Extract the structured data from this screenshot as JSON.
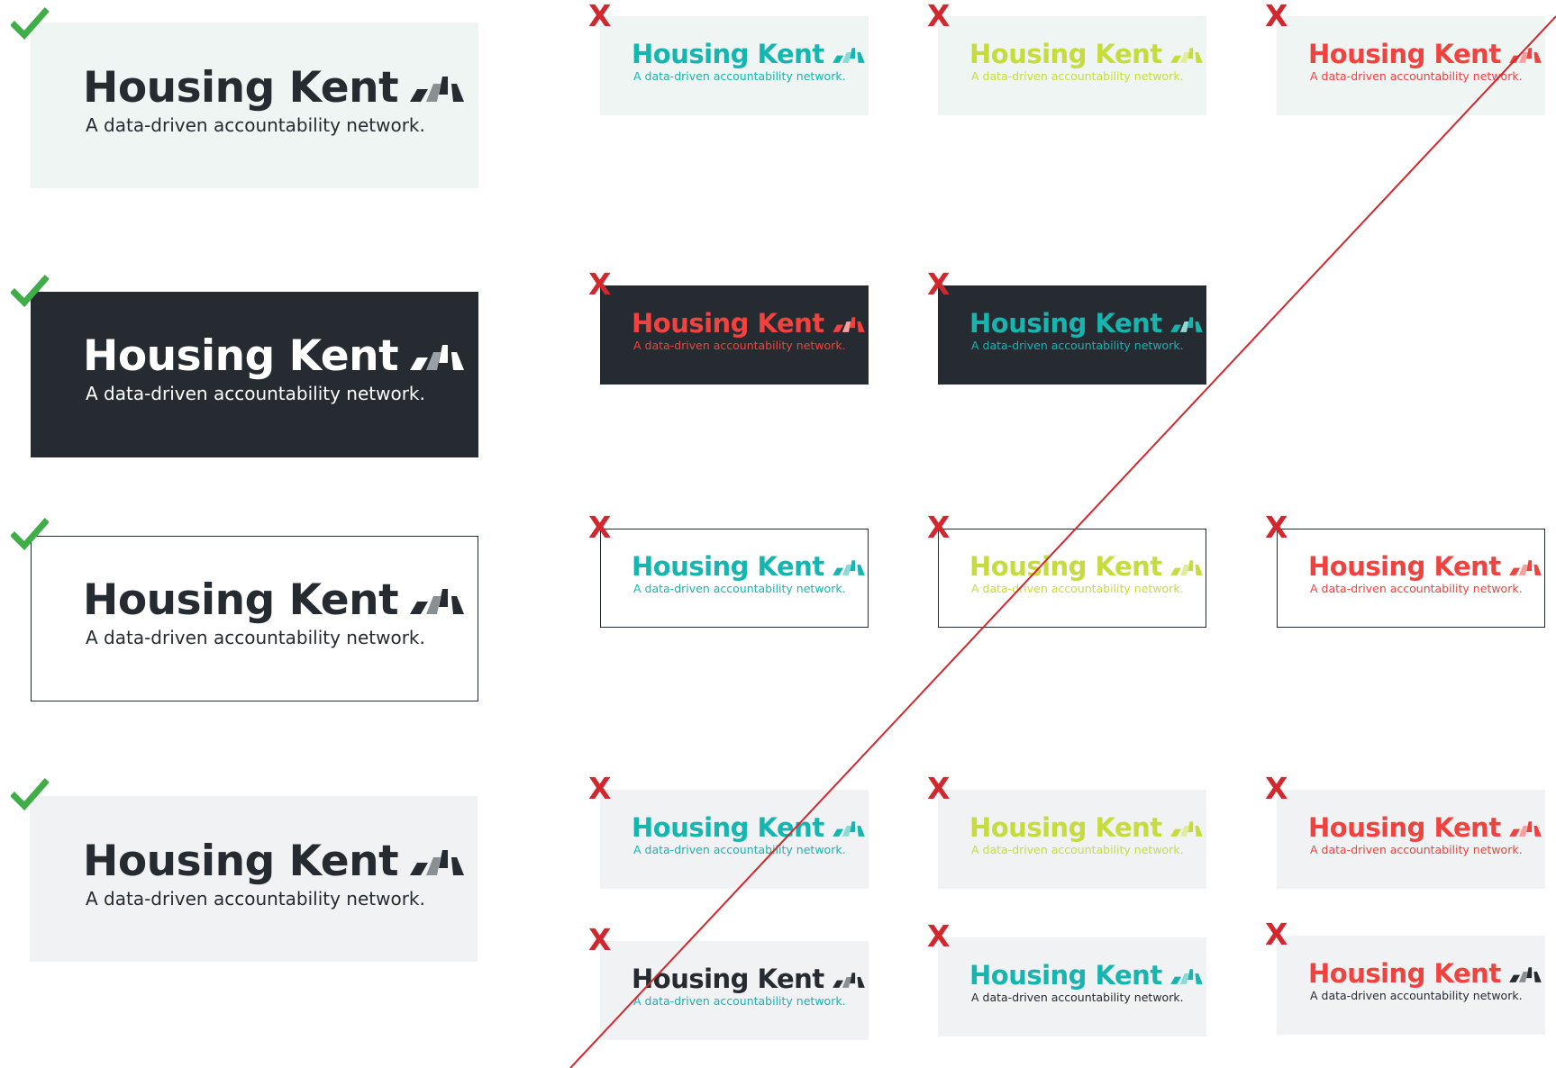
{
  "logo": {
    "title": "Housing Kent",
    "tagline": "A data-driven accountability network."
  },
  "colors": {
    "dark": "#262b31",
    "white": "#ffffff",
    "mint_bg": "#eef5f2",
    "grey_bg": "#f1f2f3",
    "teal": "#16b5b0",
    "lime": "#c6dc3c",
    "red": "#f0423e",
    "check_green": "#3fae49",
    "x_red": "#d0282e",
    "strike_red": "#d0282e"
  },
  "markers": {
    "correct": "check-icon",
    "incorrect": "x-icon",
    "x_label": "X"
  }
}
